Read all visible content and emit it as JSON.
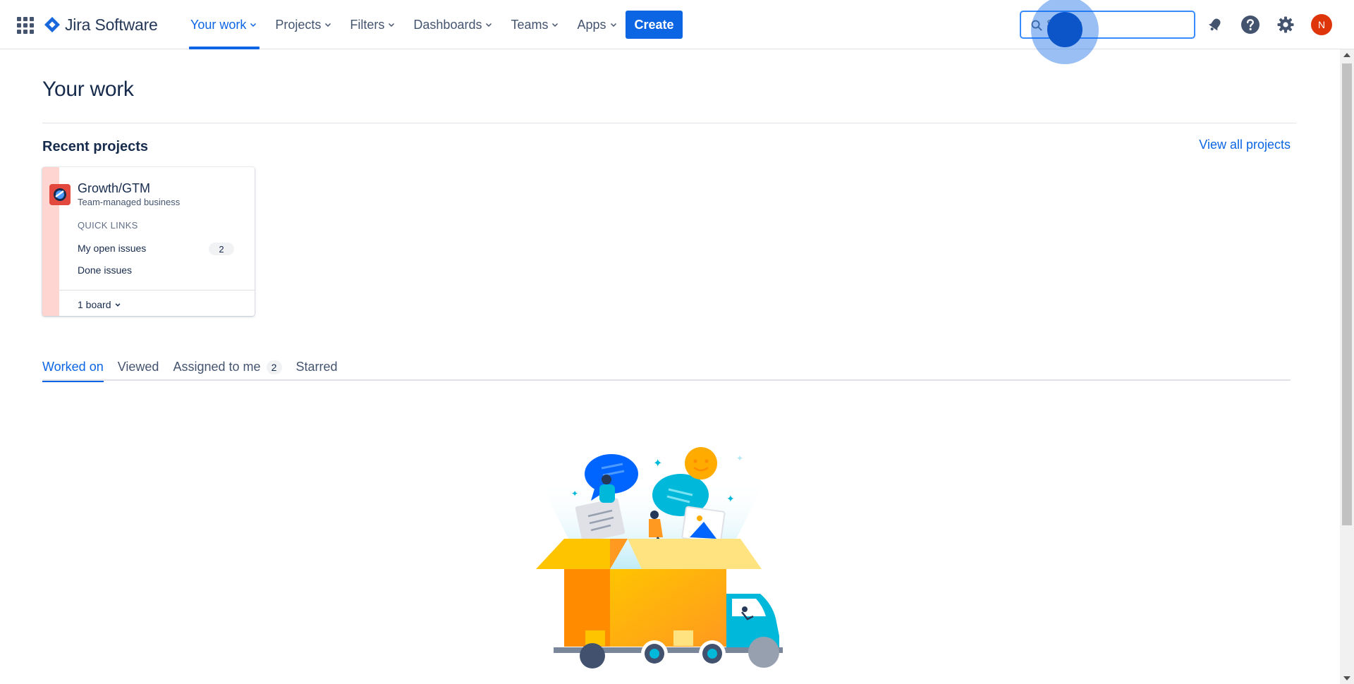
{
  "app": {
    "name": "Jira Software"
  },
  "nav": {
    "items": [
      {
        "label": "Your work",
        "active": true
      },
      {
        "label": "Projects",
        "active": false
      },
      {
        "label": "Filters",
        "active": false
      },
      {
        "label": "Dashboards",
        "active": false
      },
      {
        "label": "Teams",
        "active": false
      },
      {
        "label": "Apps",
        "active": false
      }
    ],
    "create_label": "Create"
  },
  "search": {
    "placeholder": "Search",
    "value": ""
  },
  "header_icons": [
    "notifications-icon",
    "help-icon",
    "settings-icon"
  ],
  "user": {
    "initial": "N",
    "avatar_color": "#de350b"
  },
  "page": {
    "title": "Your work"
  },
  "recent_projects": {
    "title": "Recent projects",
    "view_all": "View all projects",
    "projects": [
      {
        "name": "Growth/GTM",
        "type": "Team-managed business",
        "quick_links_title": "QUICK LINKS",
        "links": [
          {
            "label": "My open issues",
            "count": "2"
          },
          {
            "label": "Done issues",
            "count": ""
          }
        ],
        "boards_label": "1 board",
        "stripe_color": "#ffd5d2"
      }
    ]
  },
  "tabs": [
    {
      "label": "Worked on",
      "active": true,
      "count": ""
    },
    {
      "label": "Viewed",
      "active": false,
      "count": ""
    },
    {
      "label": "Assigned to me",
      "active": false,
      "count": "2"
    },
    {
      "label": "Starred",
      "active": false,
      "count": ""
    }
  ],
  "colors": {
    "accent": "#0c66e4",
    "text": "#172b4d",
    "muted": "#44546f"
  }
}
